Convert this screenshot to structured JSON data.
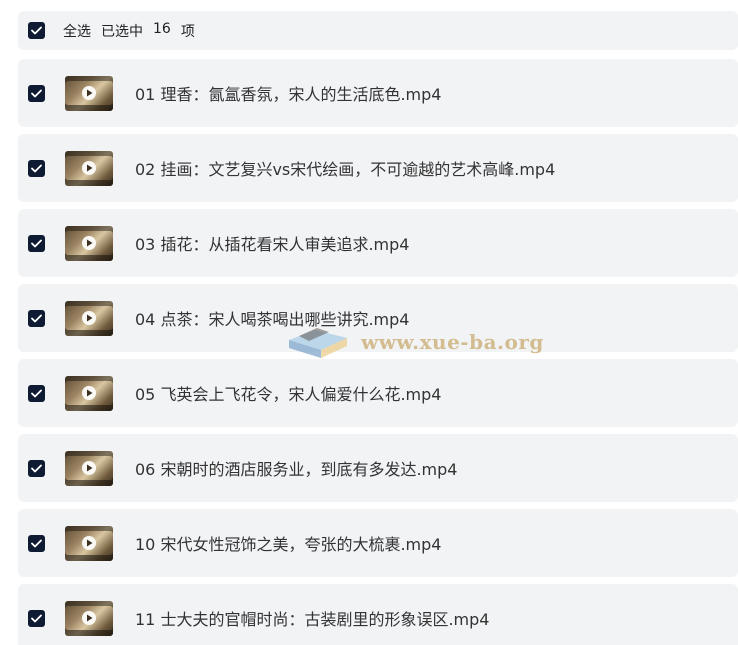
{
  "header": {
    "select_all": "全选",
    "selected_prefix": "已选中",
    "selected_count": "16",
    "selected_suffix": "项"
  },
  "files": [
    {
      "name": "01 理香：氤氲香氛，宋人的生活底色.mp4",
      "checked": true,
      "icon": "video-thumbnail-icon"
    },
    {
      "name": "02 挂画：文艺复兴vs宋代绘画，不可逾越的艺术高峰.mp4",
      "checked": true,
      "icon": "video-thumbnail-icon"
    },
    {
      "name": "03 插花：从插花看宋人审美追求.mp4",
      "checked": true,
      "icon": "video-thumbnail-icon"
    },
    {
      "name": "04 点茶：宋人喝茶喝出哪些讲究.mp4",
      "checked": true,
      "icon": "video-thumbnail-icon"
    },
    {
      "name": "05 飞英会上飞花令，宋人偏爱什么花.mp4",
      "checked": true,
      "icon": "video-thumbnail-icon"
    },
    {
      "name": "06 宋朝时的酒店服务业，到底有多发达.mp4",
      "checked": true,
      "icon": "video-thumbnail-icon"
    },
    {
      "name": "10 宋代女性冠饰之美，夸张的大梳裹.mp4",
      "checked": true,
      "icon": "video-thumbnail-icon"
    },
    {
      "name": "11 士大夫的官帽时尚：古装剧里的形象误区.mp4",
      "checked": true,
      "icon": "video-thumbnail-icon"
    }
  ],
  "watermark": {
    "text": "www.xue-ba.org"
  },
  "colors": {
    "checkbox": "#0f1b33",
    "row_background": "#f2f3f5",
    "text": "#333333"
  }
}
